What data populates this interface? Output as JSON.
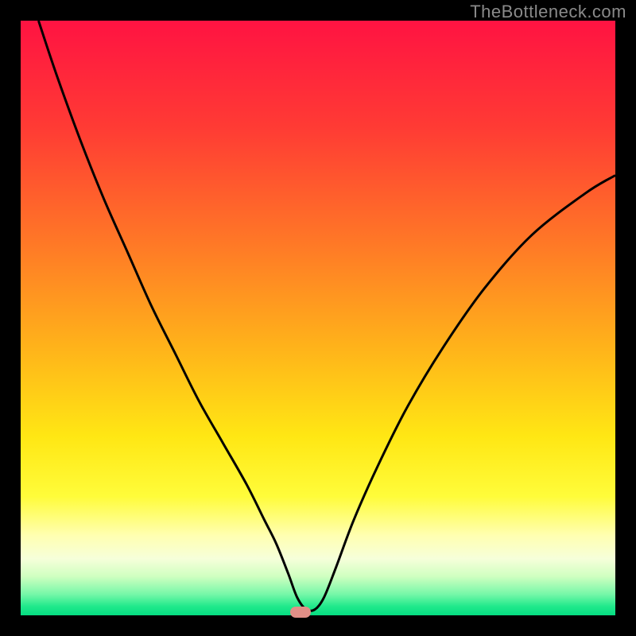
{
  "watermark": {
    "text": "TheBottleneck.com"
  },
  "colors": {
    "frame": "#000000",
    "watermark": "#8a8a8a",
    "curve": "#000000",
    "marker_fill": "#e18f87",
    "gradient_stops": [
      {
        "offset": 0.0,
        "color": "#ff1342"
      },
      {
        "offset": 0.18,
        "color": "#ff3b34"
      },
      {
        "offset": 0.38,
        "color": "#ff7a26"
      },
      {
        "offset": 0.55,
        "color": "#ffb31a"
      },
      {
        "offset": 0.7,
        "color": "#ffe714"
      },
      {
        "offset": 0.8,
        "color": "#fffc3a"
      },
      {
        "offset": 0.865,
        "color": "#ffffb0"
      },
      {
        "offset": 0.905,
        "color": "#f6ffda"
      },
      {
        "offset": 0.935,
        "color": "#cfffc0"
      },
      {
        "offset": 0.965,
        "color": "#74f7a8"
      },
      {
        "offset": 0.985,
        "color": "#20e98b"
      },
      {
        "offset": 1.0,
        "color": "#05dd82"
      }
    ]
  },
  "chart_data": {
    "type": "line",
    "title": "",
    "xlabel": "",
    "ylabel": "",
    "xlim": [
      0,
      100
    ],
    "ylim": [
      0,
      100
    ],
    "optimum_x": 47,
    "series": [
      {
        "name": "bottleneck-curve",
        "x": [
          3,
          6,
          10,
          14,
          18,
          22,
          26,
          30,
          34,
          38,
          41,
          43,
          45,
          46.5,
          48,
          49.5,
          51,
          53,
          56,
          60,
          65,
          71,
          78,
          86,
          95,
          100
        ],
        "y": [
          100,
          91,
          80,
          70,
          61,
          52,
          44,
          36,
          29,
          22,
          16,
          12,
          7,
          3,
          1,
          1,
          3,
          8,
          16,
          25,
          35,
          45,
          55,
          64,
          71,
          74
        ]
      }
    ],
    "marker": {
      "x": 47,
      "y": 0.5
    }
  }
}
